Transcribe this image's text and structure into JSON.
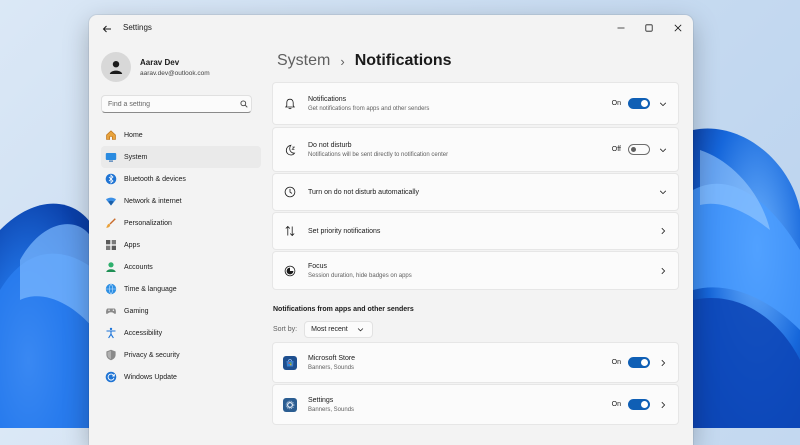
{
  "window": {
    "title": "Settings"
  },
  "profile": {
    "name": "Aarav Dev",
    "email": "aarav.dev@outlook.com"
  },
  "search": {
    "placeholder": "Find a setting"
  },
  "sidebar": {
    "items": [
      {
        "label": "Home",
        "icon": "home-icon"
      },
      {
        "label": "System",
        "icon": "system-icon",
        "selected": true
      },
      {
        "label": "Bluetooth & devices",
        "icon": "bluetooth-icon"
      },
      {
        "label": "Network & internet",
        "icon": "network-icon"
      },
      {
        "label": "Personalization",
        "icon": "brush-icon"
      },
      {
        "label": "Apps",
        "icon": "apps-icon"
      },
      {
        "label": "Accounts",
        "icon": "accounts-icon"
      },
      {
        "label": "Time & language",
        "icon": "globe-icon"
      },
      {
        "label": "Gaming",
        "icon": "gamepad-icon"
      },
      {
        "label": "Accessibility",
        "icon": "accessibility-icon"
      },
      {
        "label": "Privacy & security",
        "icon": "shield-icon"
      },
      {
        "label": "Windows Update",
        "icon": "update-icon"
      }
    ]
  },
  "breadcrumb": {
    "parent": "System",
    "separator": "›",
    "current": "Notifications"
  },
  "settings": {
    "notifications": {
      "title": "Notifications",
      "subtitle": "Get notifications from apps and other senders",
      "state_label": "On",
      "on": true
    },
    "dnd": {
      "title": "Do not disturb",
      "subtitle": "Notifications will be sent directly to notification center",
      "state_label": "Off",
      "on": false
    },
    "dnd_auto": {
      "title": "Turn on do not disturb automatically"
    },
    "priority": {
      "title": "Set priority notifications"
    },
    "focus": {
      "title": "Focus",
      "subtitle": "Session duration, hide badges on apps"
    }
  },
  "senders": {
    "section_title": "Notifications from apps and other senders",
    "sort_label": "Sort by:",
    "sort_value": "Most recent",
    "apps": [
      {
        "name": "Microsoft Store",
        "detail": "Banners, Sounds",
        "state_label": "On",
        "on": true
      },
      {
        "name": "Settings",
        "detail": "Banners, Sounds",
        "state_label": "On",
        "on": true
      }
    ]
  },
  "colors": {
    "accent": "#0f5fb5",
    "window_bg": "#f3f3f3",
    "card_bg": "#fbfbfb"
  }
}
